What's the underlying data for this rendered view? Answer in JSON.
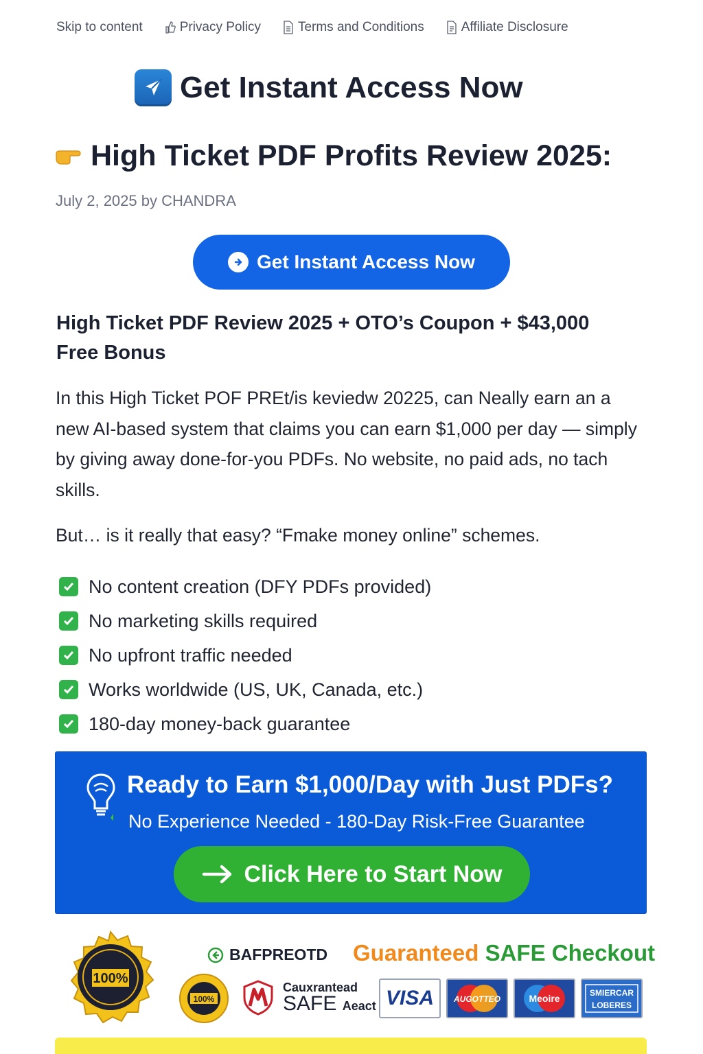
{
  "nav": {
    "skip": "Skip to content",
    "privacy": "Privacy Policy",
    "terms": "Terms and Conditions",
    "affiliate": "Affiliate Disclosure"
  },
  "hero": {
    "title": "Get Instant Access Now",
    "icon": "rocket-icon"
  },
  "post": {
    "title": "High Ticket PDF Profits Review 2025:",
    "meta": "July 2, 2025 by CHANDRA",
    "cta_label": "Get Instant Access Now",
    "subheading": "High Ticket PDF Review 2025 + OTO’s Coupon + $43,000 Free Bonus",
    "para1": "In this High Ticket POF PREt/is keviedw 20225, can Neally earn an a new AI-based system that claims you can earn $1,000 per day — simply by giving away done-for-you PDFs. No website, no paid ads, no tach skills.",
    "para2": "But… is it really that easy? “Fmake money online” schemes.",
    "checklist": [
      "No content creation (DFY PDFs provided)",
      "No marketing skills required",
      "No upfront traffic needed",
      "Works worldwide (US, UK, Canada, etc.)",
      "180-day money-back guarantee"
    ]
  },
  "promo": {
    "headline": "Ready to Earn $1,000/Day with Just PDFs?",
    "subline": "No Experience Needed - 180-Day Risk-Free Guarantee",
    "cta_label": "Click Here to Start Now",
    "bg_color": "#0b5bd9",
    "cta_color": "#31b134"
  },
  "trust": {
    "seal_text": "100%",
    "badge_text": "BAFPREOTD",
    "checkout_word1": "Guaranteed",
    "checkout_word2": "SAFE Checkout",
    "safe_line1": "Cauxrantead",
    "safe_line2": "SAFE",
    "safe_line2b": "Aeact",
    "cards": [
      "VISA",
      "AUGOTTEO",
      "Meoire",
      "SMIERCAR LOBERES"
    ]
  }
}
